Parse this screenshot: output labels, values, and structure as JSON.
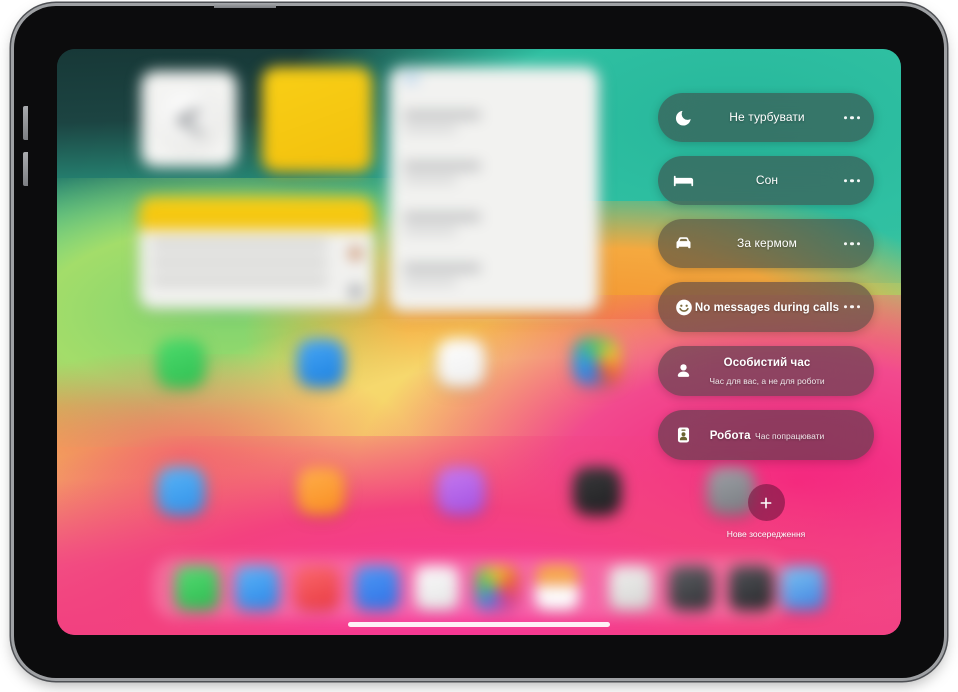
{
  "device": {
    "name": "iPad",
    "buttons": [
      "power-button",
      "volume-up-button",
      "volume-down-button"
    ]
  },
  "focus_panel": {
    "items": [
      {
        "id": "do-not-disturb",
        "title": "Не турбувати",
        "subtitle": "",
        "icon": "moon-icon",
        "more_label": "…"
      },
      {
        "id": "sleep",
        "title": "Сон",
        "subtitle": "",
        "icon": "bed-icon",
        "more_label": "…"
      },
      {
        "id": "driving",
        "title": "За кермом",
        "subtitle": "",
        "icon": "car-icon",
        "more_label": "…"
      },
      {
        "id": "no-messages-during-calls",
        "title": "No messages during calls",
        "subtitle": "",
        "icon": "smiley-face-icon",
        "more_label": "…"
      },
      {
        "id": "personal-time",
        "title": "Особистий час",
        "subtitle": "Час для вас, а не для роботи",
        "icon": "person-icon",
        "more_label": ""
      },
      {
        "id": "work",
        "title": "Робота",
        "subtitle": "Час попрацювати",
        "icon": "id-badge-icon",
        "more_label": ""
      }
    ],
    "new_focus": {
      "label": "Нове зосередження",
      "icon": "plus-icon"
    }
  },
  "home_screen": {
    "widgets": [
      {
        "id": "clock-widget",
        "icon": "analog-clock-icon"
      },
      {
        "id": "yellow-widget",
        "icon": "notes-widget-icon"
      },
      {
        "id": "notes-widget",
        "icon": "notes-list-icon"
      },
      {
        "id": "list-widget",
        "icon": "reminders-list-icon"
      }
    ],
    "app_icons_row_1": [
      "app-icon-green",
      "app-icon-blue",
      "app-icon-white",
      "app-icon-multicolor"
    ],
    "app_icons_row_2": [
      "app-icon-blue-contacts",
      "app-icon-orange",
      "app-icon-purple",
      "app-icon-dark"
    ],
    "dock_icons": [
      "dock-icon-green",
      "dock-icon-blue",
      "dock-icon-red",
      "dock-icon-blue-2",
      "dock-icon-white",
      "dock-icon-multicolor",
      "dock-icon-sunrise",
      "dock-icon-light",
      "dock-icon-dark-1",
      "dock-icon-dark-2",
      "dock-icon-files"
    ],
    "home_indicator": "home-indicator"
  },
  "colors": {
    "pill_background": "#404040",
    "pill_text": "#ffffff",
    "new_focus_background": "#5f1034",
    "wallpaper_teal": "#2fc0a2",
    "wallpaper_green": "#a3dd6a",
    "wallpaper_orange": "#f5a93f",
    "wallpaper_yellow": "#f6d86d",
    "wallpaper_pink": "#f41f7e",
    "screen_dark_top": "#173837"
  }
}
